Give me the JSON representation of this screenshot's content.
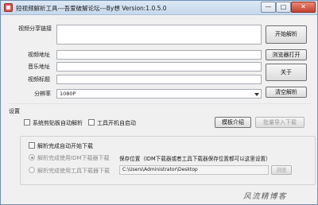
{
  "window": {
    "title": "短视频解析工具---吾爱破解论坛---By想  Version:1.0.5.0",
    "controls": {
      "minimize": "—",
      "maximize": "□",
      "close": "✕"
    }
  },
  "form": {
    "share_link_label": "视频分享链接",
    "video_url_label": "视频地址",
    "audio_url_label": "音乐地址",
    "video_title_label": "视频标题",
    "resolution_label": "分辨率",
    "resolution_value": "1080P"
  },
  "buttons": {
    "start_parse": "开始解析",
    "open_browser": "浏览器打开",
    "about": "关于",
    "clear_parse": "清空解析",
    "template_intro": "模板介绍",
    "batch_import": "批量导入下载",
    "browse": "浏览"
  },
  "settings": {
    "title": "设置",
    "monitor_clipboard": "系统剪贴板自动解析",
    "autostart": "工具开机自启动",
    "auto_download": "解析完成自动开始下载",
    "idm_download": "解析完成使用IDM下载器下载",
    "builtin_download": "解析完成使用工具下载器下载",
    "save_location_label": "保存位置（IDM下载器或者工具下载器保存位置都可以这里设置）",
    "save_path": "C:\\Users\\Administrator\\Desktop"
  },
  "watermark": "风流精博客"
}
